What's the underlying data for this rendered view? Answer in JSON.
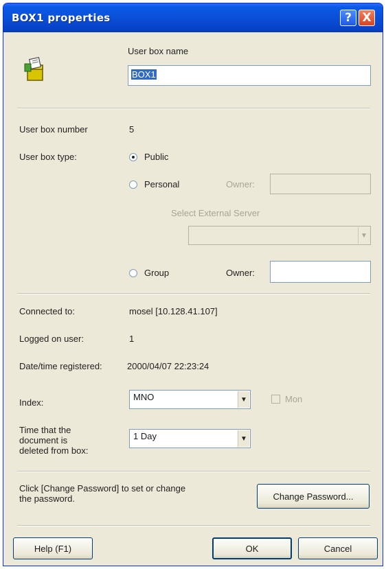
{
  "window": {
    "title": "BOX1 properties"
  },
  "titlebar_buttons": {
    "help": "?",
    "close": "X"
  },
  "user_box_name": {
    "label": "User box name",
    "value": "BOX1"
  },
  "user_box_number": {
    "label": "User box number",
    "value": "5"
  },
  "user_box_type": {
    "label": "User box type:",
    "options": [
      {
        "label": "Public",
        "checked": true
      },
      {
        "label": "Personal",
        "checked": false
      },
      {
        "label": "Group",
        "checked": false
      }
    ],
    "personal_owner_label": "Owner:",
    "select_server_label": "Select External Server",
    "group_owner_label": "Owner:"
  },
  "connected_to": {
    "label": "Connected to:",
    "value": "mosel [10.128.41.107]"
  },
  "logged_on_user": {
    "label": "Logged on user:",
    "value": "1"
  },
  "date_registered": {
    "label": "Date/time registered:",
    "value": "2000/04/07 22:23:24"
  },
  "index": {
    "label": "Index:",
    "value": "MNO",
    "checkbox_label": "Mon"
  },
  "delete_time": {
    "label_lines": [
      "Time that the",
      "document is",
      "deleted from box:"
    ],
    "value": "1 Day"
  },
  "password": {
    "hint_lines": [
      "Click [Change Password] to set or change",
      "the password."
    ],
    "button_label": "Change Password..."
  },
  "footer": {
    "help_label": "Help (F1)",
    "ok_label": "OK",
    "cancel_label": "Cancel"
  }
}
